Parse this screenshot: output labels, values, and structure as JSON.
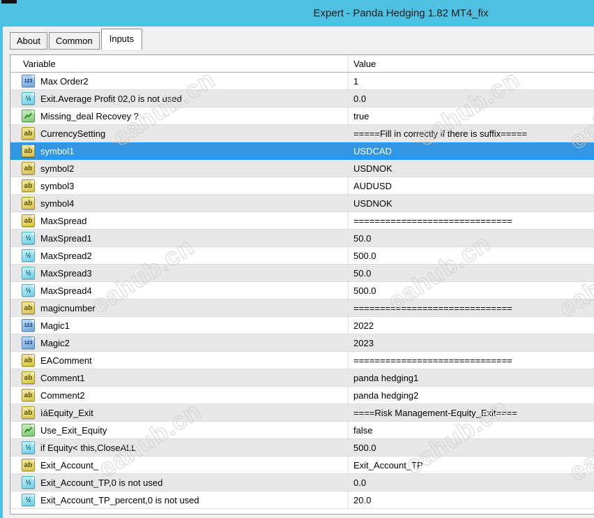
{
  "window": {
    "title": "Expert - Panda Hedging 1.82 MT4_fix"
  },
  "tabs": [
    {
      "label": "About",
      "active": false
    },
    {
      "label": "Common",
      "active": false
    },
    {
      "label": "Inputs",
      "active": true
    }
  ],
  "grid": {
    "columns": [
      "Variable",
      "Value"
    ],
    "rows": [
      {
        "type": "int",
        "label": "Max Order2",
        "value": "1",
        "selected": false
      },
      {
        "type": "double",
        "label": "Exit.Average Profit 02,0 is not used",
        "value": "0.0",
        "selected": false
      },
      {
        "type": "bool",
        "label": "Missing_deal Recovey ?",
        "value": "true",
        "selected": false
      },
      {
        "type": "string",
        "label": "CurrencySetting",
        "value": "=====Fill in correctly if there is suffix=====",
        "selected": false
      },
      {
        "type": "string",
        "label": "symbol1",
        "value": "USDCAD",
        "selected": true
      },
      {
        "type": "string",
        "label": "symbol2",
        "value": "USDNOK",
        "selected": false
      },
      {
        "type": "string",
        "label": "symbol3",
        "value": "AUDUSD",
        "selected": false
      },
      {
        "type": "string",
        "label": "symbol4",
        "value": "USDNOK",
        "selected": false
      },
      {
        "type": "string",
        "label": "MaxSpread",
        "value": "==============================",
        "selected": false
      },
      {
        "type": "double",
        "label": "MaxSpread1",
        "value": "50.0",
        "selected": false
      },
      {
        "type": "double",
        "label": "MaxSpread2",
        "value": "500.0",
        "selected": false
      },
      {
        "type": "double",
        "label": "MaxSpread3",
        "value": "50.0",
        "selected": false
      },
      {
        "type": "double",
        "label": "MaxSpread4",
        "value": "500.0",
        "selected": false
      },
      {
        "type": "string",
        "label": "magicnumber",
        "value": "==============================",
        "selected": false
      },
      {
        "type": "int",
        "label": "Magic1",
        "value": "2022",
        "selected": false
      },
      {
        "type": "int",
        "label": "Magic2",
        "value": "2023",
        "selected": false
      },
      {
        "type": "string",
        "label": "EAComment",
        "value": "==============================",
        "selected": false
      },
      {
        "type": "string",
        "label": "Comment1",
        "value": "panda hedging1",
        "selected": false
      },
      {
        "type": "string",
        "label": "Comment2",
        "value": "panda hedging2",
        "selected": false
      },
      {
        "type": "string",
        "label": "ìáEquity_Exit",
        "value": "====Risk Management-Equity_Exit====",
        "selected": false
      },
      {
        "type": "bool",
        "label": "Use_Exit_Equity",
        "value": "false",
        "selected": false
      },
      {
        "type": "double",
        "label": "if Equity< this,CloseALL",
        "value": "500.0",
        "selected": false
      },
      {
        "type": "string",
        "label": "Exit_Account_",
        "value": "Exit_Account_TP",
        "selected": false
      },
      {
        "type": "double",
        "label": "Exit_Account_TP,0 is not used",
        "value": "0.0",
        "selected": false
      },
      {
        "type": "double",
        "label": "Exit_Account_TP_percent,0 is not used",
        "value": "20.0",
        "selected": false
      }
    ],
    "icon_text": {
      "int": "123",
      "double": "½",
      "string": "ab"
    }
  },
  "watermark": {
    "text": "eahub.cn"
  },
  "colors": {
    "titlebar": "#4ec1e2",
    "selection": "#3296e4",
    "row_alt": "#e8e8e8",
    "icon_int": "#6fa8dc",
    "icon_double": "#6ecfe6",
    "icon_bool": "#7ccb72",
    "icon_string": "#d9c44e"
  }
}
